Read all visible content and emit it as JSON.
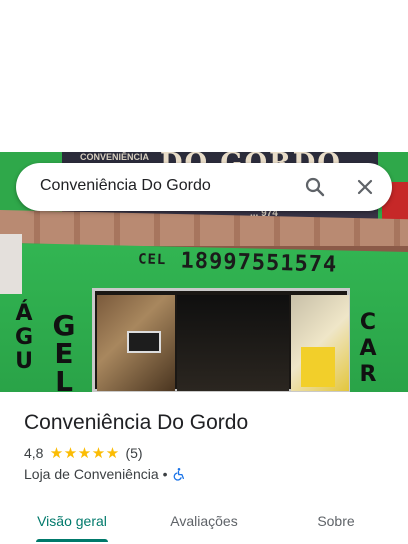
{
  "search": {
    "query": "Conveniência Do Gordo",
    "search_icon": "search-icon",
    "close_icon": "close-icon"
  },
  "photo": {
    "sign_top": "DO GORDO",
    "sign_small": "CONVENIÊNCIA",
    "sign_phone_small": "... 974",
    "phone_label": "CEL",
    "phone_number": "18997551574",
    "left_letters": "ÁGU",
    "gel_letters": "GEL",
    "car_letters": "CAR"
  },
  "place": {
    "title": "Conveniência Do Gordo",
    "rating": "4,8",
    "stars": 5,
    "review_count": "(5)",
    "category": "Loja de Conveniência",
    "separator": "•",
    "accessibility_icon": "wheelchair-icon"
  },
  "tabs": [
    {
      "label": "Visão geral",
      "active": true
    },
    {
      "label": "Avaliações",
      "active": false
    },
    {
      "label": "Sobre",
      "active": false
    }
  ],
  "colors": {
    "accent": "#00796b",
    "star": "#fbbc04",
    "text": "#202124",
    "secondary": "#5f6368"
  }
}
